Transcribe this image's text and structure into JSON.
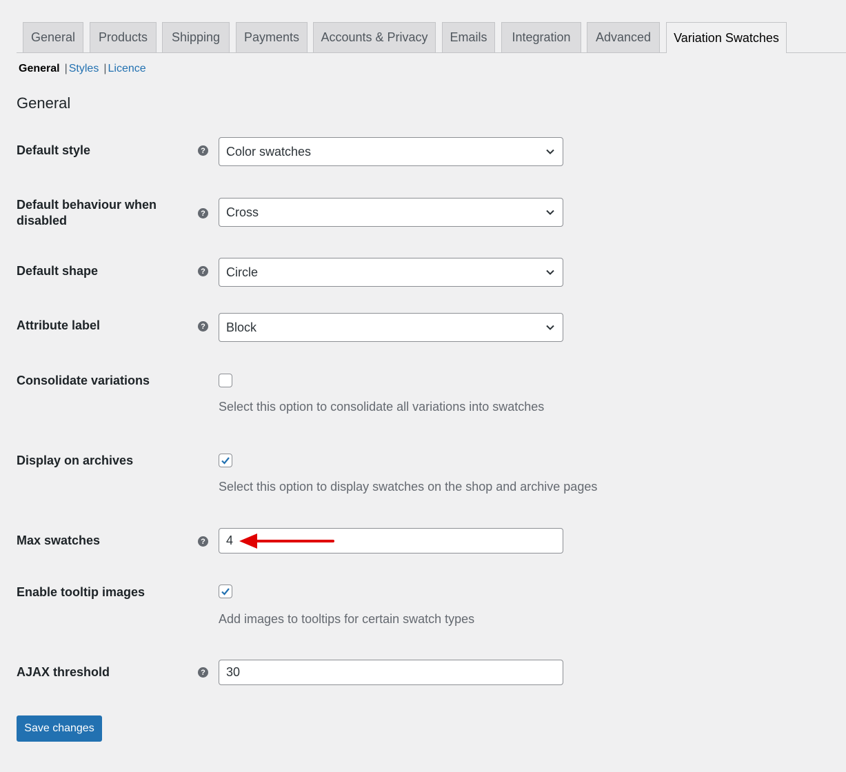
{
  "tabs": [
    {
      "label": "General"
    },
    {
      "label": "Products"
    },
    {
      "label": "Shipping"
    },
    {
      "label": "Payments"
    },
    {
      "label": "Accounts & Privacy"
    },
    {
      "label": "Emails"
    },
    {
      "label": "Integration"
    },
    {
      "label": "Advanced"
    },
    {
      "label": "Variation Swatches",
      "active": true
    }
  ],
  "subnav": {
    "current": "General",
    "separator": "|",
    "links": [
      "Styles",
      "Licence"
    ]
  },
  "section_title": "General",
  "fields": {
    "default_style": {
      "label": "Default style",
      "value": "Color swatches"
    },
    "disabled_behaviour": {
      "label": "Default behaviour when disabled",
      "value": "Cross"
    },
    "default_shape": {
      "label": "Default shape",
      "value": "Circle"
    },
    "attribute_label": {
      "label": "Attribute label",
      "value": "Block"
    },
    "consolidate": {
      "label": "Consolidate variations",
      "checked": false,
      "description": "Select this option to consolidate all variations into swatches"
    },
    "archives": {
      "label": "Display on archives",
      "checked": true,
      "description": "Select this option to display swatches on the shop and archive pages"
    },
    "max_swatches": {
      "label": "Max swatches",
      "value": "4"
    },
    "tooltip_images": {
      "label": "Enable tooltip images",
      "checked": true,
      "description": "Add images to tooltips for certain swatch types"
    },
    "ajax_threshold": {
      "label": "AJAX threshold",
      "value": "30"
    }
  },
  "help_icon_glyph": "?",
  "save_label": "Save changes",
  "colors": {
    "accent": "#2271b1",
    "annotation_arrow": "#e00000"
  }
}
